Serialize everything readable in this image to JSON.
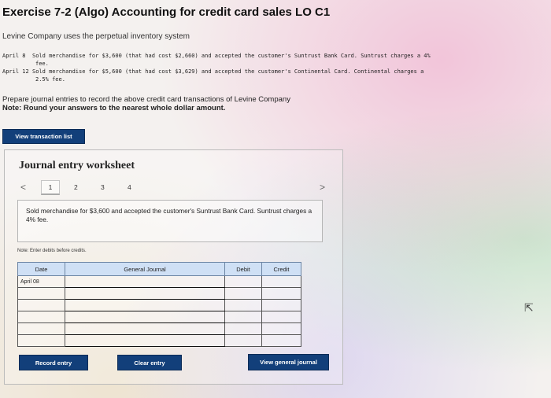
{
  "header": {
    "title": "Exercise 7-2 (Algo) Accounting for credit card sales LO C1",
    "intro": "Levine Company uses the perpetual inventory system"
  },
  "transactions": [
    {
      "date": "April 8",
      "text": "Sold merchandise for $3,600 (that had cost $2,660) and accepted the customer's Suntrust Bank Card. Suntrust charges a 4%",
      "cont": "fee."
    },
    {
      "date": "April 12",
      "text": "Sold merchandise for $5,600 (that had cost $3,629) and accepted the customer's Continental Card. Continental charges a",
      "cont": "2.5% fee."
    }
  ],
  "instructions": {
    "prepare": "Prepare journal entries to record the above credit card transactions of Levine Company",
    "note": "Note: Round your answers to the nearest whole dollar amount."
  },
  "buttons": {
    "view_transaction_list": "View transaction list",
    "record_entry": "Record entry",
    "clear_entry": "Clear entry",
    "view_general_journal": "View general journal"
  },
  "worksheet": {
    "title": "Journal entry worksheet",
    "prev_glyph": "<",
    "next_glyph": ">",
    "tabs": [
      "1",
      "2",
      "3",
      "4"
    ],
    "description": "Sold merchandise for $3,600 and accepted the customer's Suntrust Bank Card. Suntrust charges a 4% fee.",
    "note": "Note: Enter debits before credits.",
    "table": {
      "headers": {
        "date": "Date",
        "journal": "General Journal",
        "debit": "Debit",
        "credit": "Credit"
      },
      "first_date": "April 08"
    }
  },
  "colors": {
    "button": "#123f7a",
    "header_cell": "#cfe0f5"
  }
}
